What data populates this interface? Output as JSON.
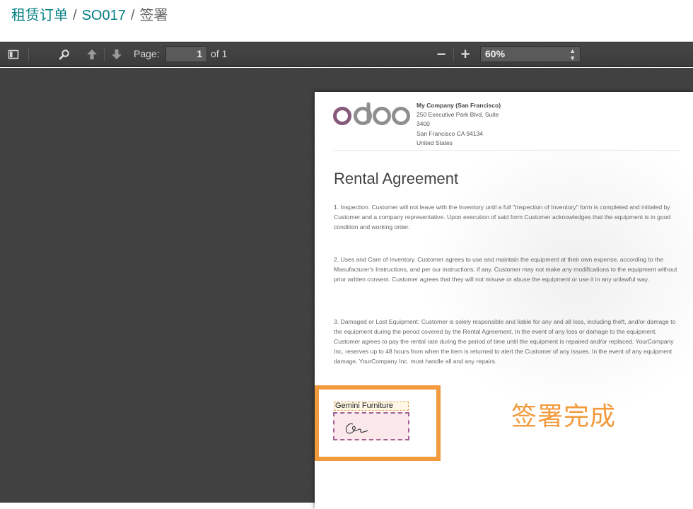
{
  "breadcrumb": {
    "items": [
      "租赁订单",
      "SO017"
    ],
    "separator": "/",
    "current": "签署"
  },
  "toolbar": {
    "page_label": "Page:",
    "page_value": "1",
    "page_total": "of 1",
    "zoom_out": "−",
    "zoom_in": "+",
    "zoom_value": "60%",
    "icons": [
      "sidebar-toggle-icon",
      "search-icon",
      "arrow-up-icon",
      "arrow-down-icon"
    ]
  },
  "document": {
    "company": {
      "name": "My Company (San Francisco)",
      "address_lines": [
        "250 Executive Park Blvd, Suite",
        "3400",
        "San Francisco CA 94134",
        "United States"
      ]
    },
    "title": "Rental Agreement",
    "clauses": [
      "1. Inspection. Customer will not leave with the  Inventory until a full \"Inspection of Inventory\" form is completed and initialed by Customer and a company representative. Upon execution of said form Customer acknowledges that the equipment is in good condition and working order.",
      "2. Uses and Care of Inventory. Customer agrees to use and maintain  the equipment at their own expense, according to the Manufacturer's Instructions, and per our instructions, if any. Customer may not make any modifications to the equipment without prior written consent. Customer agrees that they will not misuse or abuse the equipment or use it in any unlawful way.",
      "3. Damaged or Lost Equipment: Customer is solely responsible and  liable for any and all loss, including theft, and/or damage to the equipment during the period covered by the Rental Agreement. In the event of any loss or damage to the equipment, Customer agrees to pay the rental rate during the period of time until the equipment is repaired and/or replaced. YourCompany Inc. reserves up to 48 hours from when the item is returned to alert the Customer of any issues. In the event of any equipment damage, YourCompany Inc. must handle all and any repairs."
    ],
    "signer_name": "Gemini Furniture"
  },
  "annotation": {
    "text": "签署完成",
    "color": "#f39a3d"
  },
  "colors": {
    "link": "#017e84",
    "toolbar": "#474747",
    "viewer_bg": "#404040",
    "highlight": "#f39a3d",
    "signature_border": "#a45f94"
  }
}
